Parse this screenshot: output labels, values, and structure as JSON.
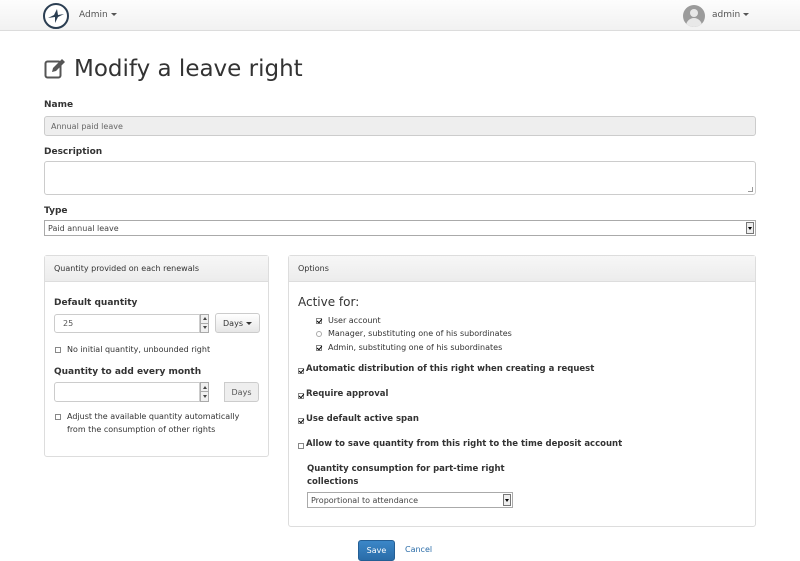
{
  "navbar": {
    "menu_label": "Admin",
    "user_label": "admin"
  },
  "page": {
    "title": "Modify a leave right"
  },
  "form": {
    "name_label": "Name",
    "name_value": "Annual paid leave",
    "description_label": "Description",
    "description_value": "",
    "type_label": "Type",
    "type_value": "Paid annual leave"
  },
  "quantity_panel": {
    "heading": "Quantity provided on each renewals",
    "default_quantity_label": "Default quantity",
    "default_quantity_value": "25",
    "unit_button": "Days",
    "no_initial_label": "No initial quantity, unbounded right",
    "no_initial_checked": false,
    "monthly_label": "Quantity to add every month",
    "monthly_value": "",
    "monthly_unit": "Days",
    "adjust_label_line1": "Adjust the available quantity automatically",
    "adjust_label_line2": "from the consumption of other rights",
    "adjust_checked": false
  },
  "options_panel": {
    "heading": "Options",
    "active_for_title": "Active for:",
    "active_for": [
      {
        "label": "User account",
        "checked": true
      },
      {
        "label": "Manager, substituting one of his subordinates",
        "checked": false
      },
      {
        "label": "Admin, substituting one of his subordinates",
        "checked": true
      }
    ],
    "auto_distribution_label": "Automatic distribution of this right when creating a request",
    "auto_distribution_checked": true,
    "require_approval_label": "Require approval",
    "require_approval_checked": true,
    "default_span_label": "Use default active span",
    "default_span_checked": true,
    "time_deposit_label": "Allow to save quantity from this right to the time deposit account",
    "time_deposit_checked": false,
    "parttime_label_line1": "Quantity consumption for part-time right",
    "parttime_label_line2": "collections",
    "parttime_value": "Proportional to attendance"
  },
  "actions": {
    "save": "Save",
    "cancel": "Cancel"
  }
}
